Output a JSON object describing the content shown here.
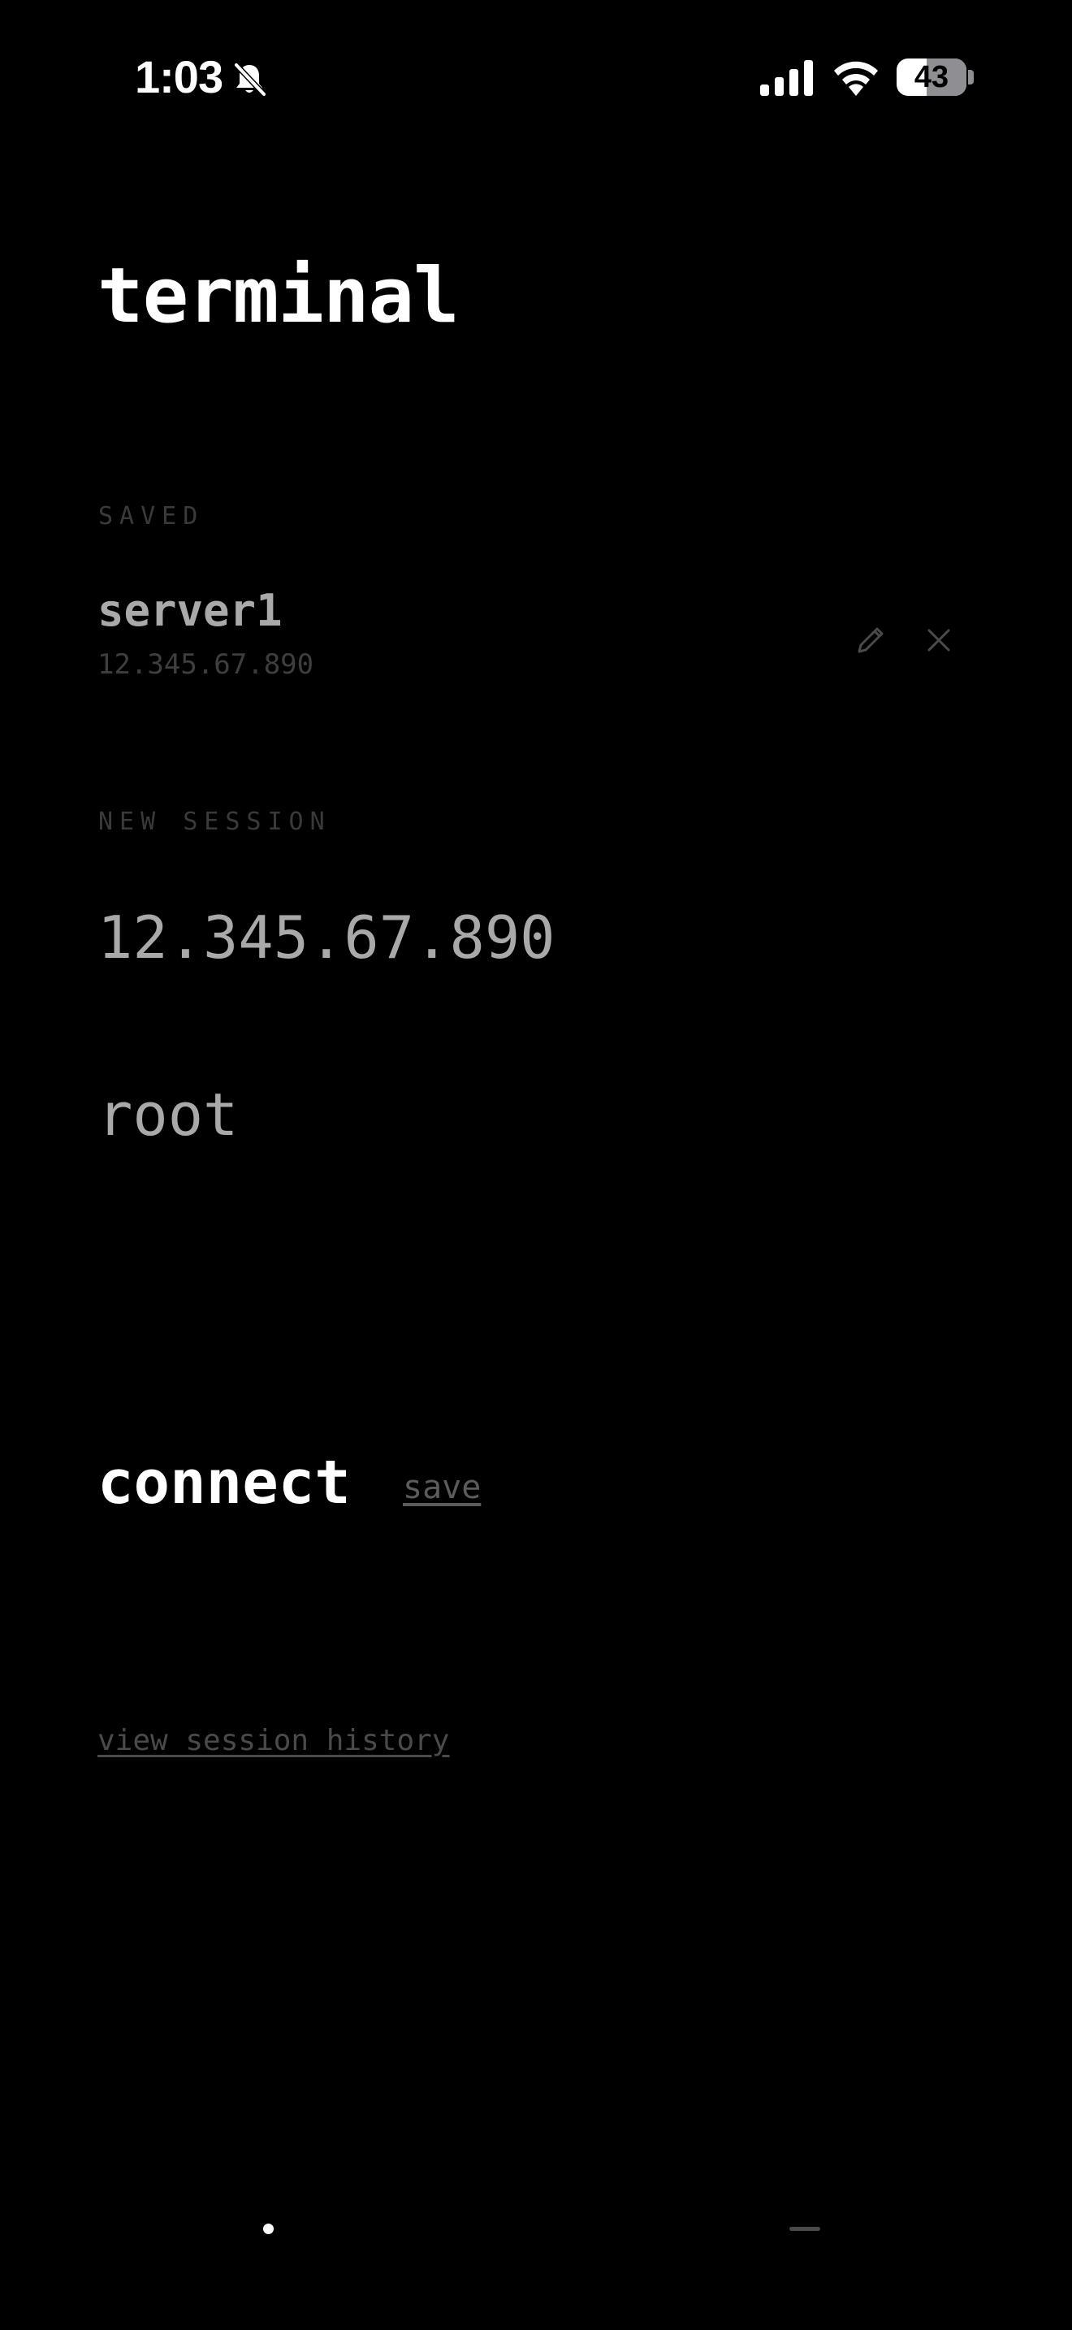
{
  "status_bar": {
    "time": "1:03",
    "battery_level": 43,
    "battery_text": "43",
    "icons": [
      "bell-off-icon",
      "signal-icon",
      "wifi-icon",
      "battery-icon"
    ]
  },
  "title": "terminal",
  "saved": {
    "label": "SAVED",
    "items": [
      {
        "name": "server1",
        "host": "12.345.67.890"
      }
    ],
    "item_icons": [
      "pencil-icon",
      "close-icon"
    ]
  },
  "new_session": {
    "label": "NEW SESSION",
    "host_value": "12.345.67.890",
    "user_value": "root"
  },
  "actions": {
    "connect_label": "connect",
    "save_label": "save",
    "history_label": "view session history"
  },
  "pager": {
    "page_count": 2,
    "current_page": 1
  },
  "colors": {
    "background": "#000000",
    "primary_text": "#ffffff",
    "field_text": "#a9a9a9",
    "muted_label": "#3a3a3a",
    "link": "#5b5b5b"
  }
}
